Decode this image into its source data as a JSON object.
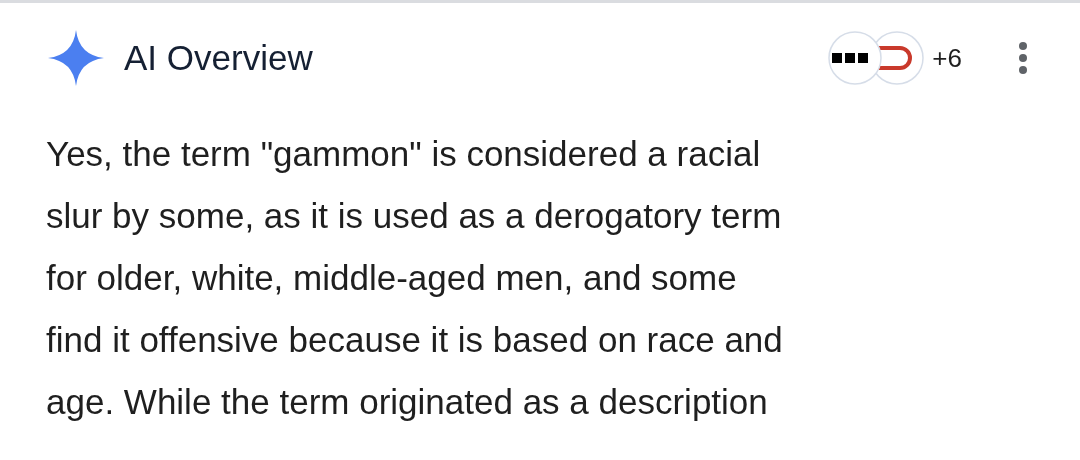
{
  "header": {
    "title": "AI Overview",
    "sources_more": "+6"
  },
  "answer": {
    "lines": [
      "Yes, the term \"gammon\" is considered a racial",
      "slur by some, as it is used as a derogatory term",
      "for older, white, middle-aged men, and some",
      "find it offensive because it is based on race and",
      "age. While the term originated as a description"
    ]
  }
}
